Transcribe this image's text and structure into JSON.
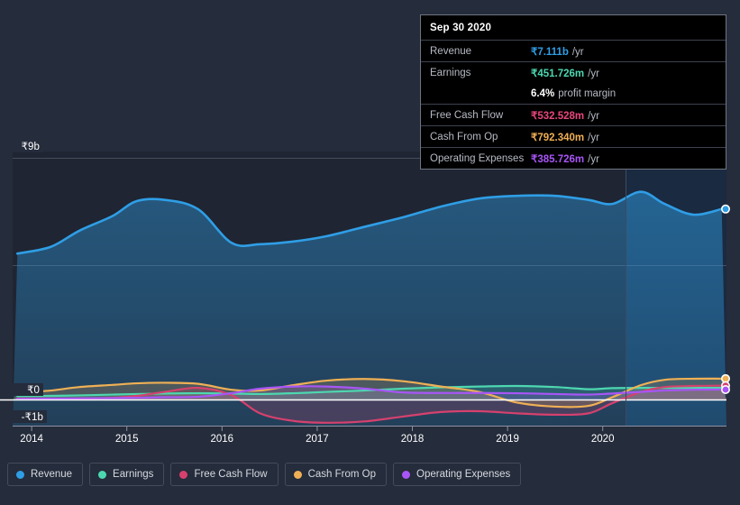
{
  "colors": {
    "background": "#252c3b",
    "plot_background": "#1f2532",
    "forecast_background": "#1e2f47",
    "zero_line": "#ffffff",
    "gridline": "#555d6e",
    "revenue": "#2f9ee6",
    "earnings": "#4dd7b0",
    "free_cash_flow": "#d6416e",
    "cash_from_op": "#efb055",
    "operating_expenses": "#a855f7"
  },
  "tooltip": {
    "title": "Sep 30 2020",
    "rows": [
      {
        "key": "Revenue",
        "value": "₹7.111b",
        "unit": "/yr",
        "color": "#2f9ee6"
      },
      {
        "key": "Earnings",
        "value": "₹451.726m",
        "unit": "/yr",
        "color": "#4dd7b0"
      },
      {
        "key": "",
        "value": "6.4%",
        "unit": "profit margin",
        "color": "#ffffff"
      },
      {
        "key": "Free Cash Flow",
        "value": "₹532.528m",
        "unit": "/yr",
        "color": "#e8467c"
      },
      {
        "key": "Cash From Op",
        "value": "₹792.340m",
        "unit": "/yr",
        "color": "#efb055"
      },
      {
        "key": "Operating Expenses",
        "value": "₹385.726m",
        "unit": "/yr",
        "color": "#a855f7"
      }
    ]
  },
  "legend": {
    "items": [
      {
        "label": "Revenue",
        "color": "#2f9ee6"
      },
      {
        "label": "Earnings",
        "color": "#4dd7b0"
      },
      {
        "label": "Free Cash Flow",
        "color": "#d6416e"
      },
      {
        "label": "Cash From Op",
        "color": "#efb055"
      },
      {
        "label": "Operating Expenses",
        "color": "#a855f7"
      }
    ]
  },
  "axis": {
    "y_top_label": "₹9b",
    "y_zero_label": "₹0",
    "y_bottom_label": "-₹1b",
    "x_labels": [
      "2014",
      "2015",
      "2016",
      "2017",
      "2018",
      "2019",
      "2020"
    ]
  },
  "chart_data": {
    "type": "area",
    "title": "",
    "xlabel": "",
    "ylabel": "",
    "ylim": [
      -1,
      9
    ],
    "y_ticks": [
      9,
      0,
      -1
    ],
    "y_tick_labels": [
      "₹9b",
      "₹0",
      "-₹1b"
    ],
    "currency": "INR",
    "units": "billions",
    "grid": true,
    "legend_position": "bottom",
    "x_ticks": [
      2014,
      2015,
      2016,
      2017,
      2018,
      2019,
      2020
    ],
    "x_range": [
      2013.8,
      2021.3
    ],
    "forecast_start_x": 2019.85,
    "x": [
      2013.85,
      2014.2,
      2014.5,
      2014.85,
      2015.1,
      2015.4,
      2015.75,
      2016.1,
      2016.4,
      2016.75,
      2017.1,
      2017.5,
      2017.9,
      2018.3,
      2018.7,
      2019.1,
      2019.5,
      2019.85,
      2020.1,
      2020.4,
      2020.65,
      2020.95,
      2021.25
    ],
    "series": [
      {
        "name": "Revenue",
        "color": "#2f9ee6",
        "values": [
          5.45,
          5.7,
          6.3,
          6.85,
          7.4,
          7.45,
          7.1,
          5.85,
          5.8,
          5.9,
          6.1,
          6.45,
          6.8,
          7.2,
          7.5,
          7.6,
          7.6,
          7.45,
          7.3,
          7.75,
          7.3,
          6.9,
          7.11
        ]
      },
      {
        "name": "Earnings",
        "color": "#4dd7b0",
        "values": [
          0.14,
          0.15,
          0.17,
          0.2,
          0.22,
          0.24,
          0.25,
          0.24,
          0.22,
          0.25,
          0.3,
          0.35,
          0.42,
          0.47,
          0.5,
          0.52,
          0.48,
          0.4,
          0.44,
          0.45,
          0.45,
          0.45,
          0.452
        ]
      },
      {
        "name": "Free Cash Flow",
        "color": "#d6416e",
        "values": [
          0.05,
          0.05,
          0.05,
          0.08,
          0.15,
          0.3,
          0.45,
          0.18,
          -0.5,
          -0.78,
          -0.85,
          -0.8,
          -0.62,
          -0.45,
          -0.42,
          -0.5,
          -0.55,
          -0.5,
          -0.12,
          0.3,
          0.48,
          0.52,
          0.533
        ]
      },
      {
        "name": "Cash From Op",
        "color": "#efb055",
        "values": [
          0.26,
          0.35,
          0.48,
          0.56,
          0.62,
          0.64,
          0.6,
          0.38,
          0.35,
          0.55,
          0.72,
          0.78,
          0.7,
          0.5,
          0.3,
          -0.1,
          -0.25,
          -0.22,
          0.1,
          0.55,
          0.75,
          0.79,
          0.792
        ]
      },
      {
        "name": "Operating Expenses",
        "color": "#a855f7",
        "values": [
          0.04,
          0.05,
          0.06,
          0.07,
          0.08,
          0.1,
          0.12,
          0.25,
          0.42,
          0.5,
          0.5,
          0.42,
          0.28,
          0.26,
          0.26,
          0.25,
          0.22,
          0.2,
          0.24,
          0.3,
          0.35,
          0.38,
          0.386
        ]
      }
    ],
    "end_markers": [
      {
        "name": "Revenue",
        "value": 7.111,
        "color": "#2f9ee6"
      },
      {
        "name": "Cash From Op",
        "value": 0.792,
        "color": "#efb055"
      },
      {
        "name": "Free Cash Flow",
        "value": 0.533,
        "color": "#d6416e"
      },
      {
        "name": "Operating Expenses",
        "value": 0.386,
        "color": "#a855f7"
      }
    ]
  }
}
